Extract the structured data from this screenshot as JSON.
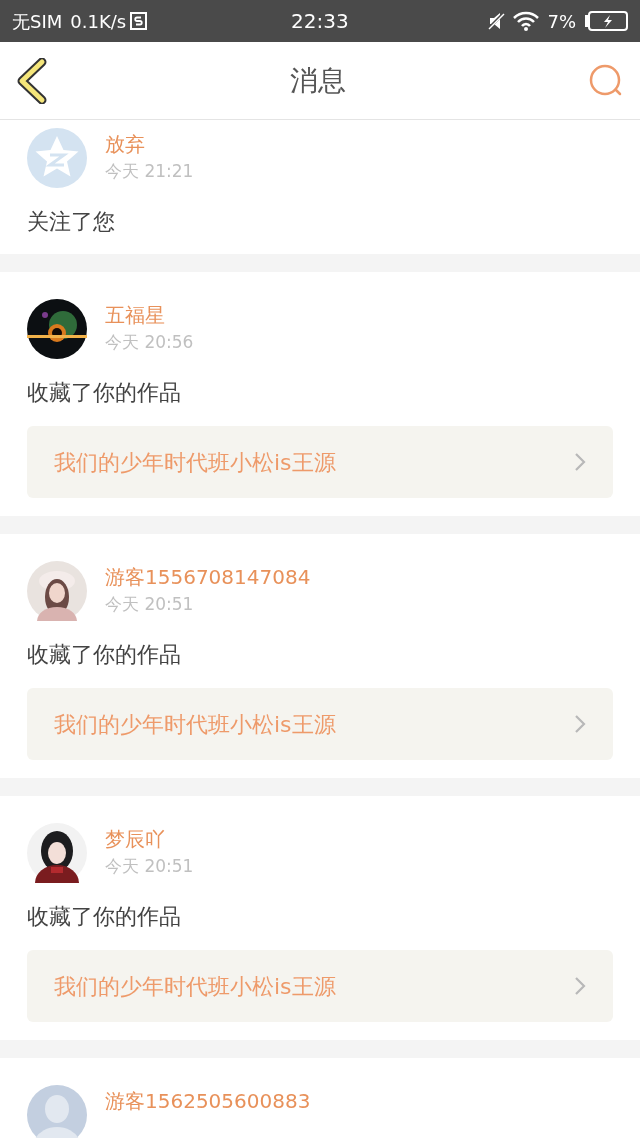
{
  "status_bar": {
    "carrier": "无SIM",
    "speed": "0.1K/s",
    "time": "22:33",
    "battery": "7%"
  },
  "header": {
    "title": "消息"
  },
  "messages": [
    {
      "name": "放弃",
      "time": "今天 21:21",
      "action": "关注了您",
      "kind": "star"
    },
    {
      "name": "五福星",
      "time": "今天 20:56",
      "action": "收藏了你的作品",
      "work": "我们的少年时代班小松is王源"
    },
    {
      "name": "游客1556708147084",
      "time": "今天 20:51",
      "action": "收藏了你的作品",
      "work": "我们的少年时代班小松is王源"
    },
    {
      "name": "梦辰吖",
      "time": "今天 20:51",
      "action": "收藏了你的作品",
      "work": "我们的少年时代班小松is王源"
    },
    {
      "name": "游客1562505600883",
      "kind": "silhouette"
    }
  ]
}
